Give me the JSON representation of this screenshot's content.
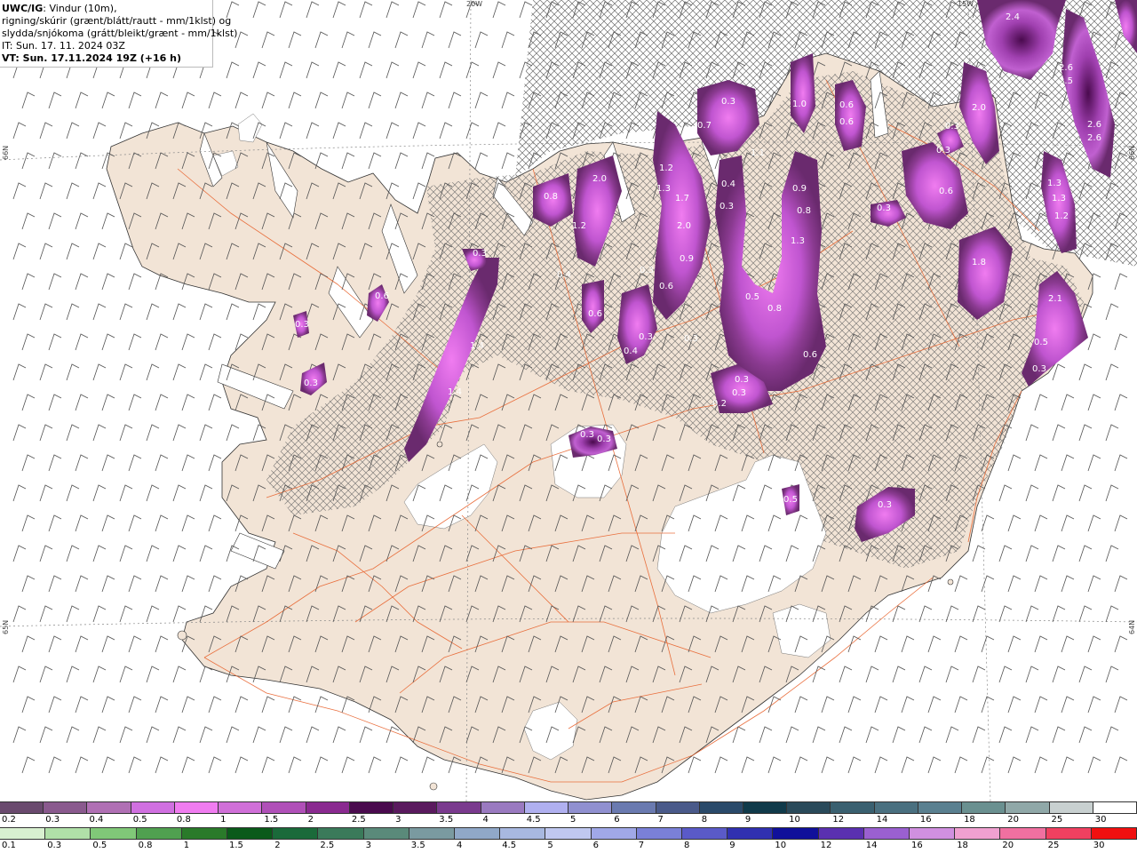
{
  "header": {
    "model": "UWC/IG",
    "line1_rest": ": Vindur (10m),",
    "line2": "rigning/skúrir (grænt/blátt/rautt - mm/1klst) og",
    "line3": "slydda/snjókoma (grátt/bleikt/grænt - mm/1klst)",
    "issue_time": "IT: Sun. 17. 11. 2024 03Z",
    "valid_time": "VT: Sun. 17.11.2024 19Z (+16 h)"
  },
  "grid_labels": {
    "top_20w": "20W",
    "top_15w": "15W",
    "left_66n": "66N",
    "left_65n": "65N",
    "right_66n": "66N",
    "right_64n": "64N"
  },
  "colors": {
    "land": "#f2e4d6",
    "sea": "#ffffff",
    "roads": "#e8622c",
    "hatch": "#6f6f6f",
    "precip_light": "#f07cf0",
    "precip_medium": "#b24ac0",
    "precip_dark": "#6a2a6e"
  },
  "precip_values": [
    {
      "v": "0.3"
    },
    {
      "v": "0.6"
    },
    {
      "v": "0.3"
    },
    {
      "v": "0.3"
    },
    {
      "v": "1.4"
    },
    {
      "v": "1.4"
    },
    {
      "v": "0.8"
    },
    {
      "v": "2.0"
    },
    {
      "v": "1.2"
    },
    {
      "v": "0.4"
    },
    {
      "v": "0.6"
    },
    {
      "v": "0.3"
    },
    {
      "v": "1.2"
    },
    {
      "v": "1.3"
    },
    {
      "v": "1.7"
    },
    {
      "v": "2.0"
    },
    {
      "v": "0.9"
    },
    {
      "v": "0.6"
    },
    {
      "v": "0.3"
    },
    {
      "v": "0.4"
    },
    {
      "v": "0.3"
    },
    {
      "v": "0.7"
    },
    {
      "v": "0.3"
    },
    {
      "v": "1.0"
    },
    {
      "v": "1.1"
    },
    {
      "v": "0.4"
    },
    {
      "v": "0.3"
    },
    {
      "v": "0.9"
    },
    {
      "v": "0.8"
    },
    {
      "v": "1.3"
    },
    {
      "v": "0.5"
    },
    {
      "v": "0.8"
    },
    {
      "v": "0.6"
    },
    {
      "v": "0.3"
    },
    {
      "v": "0.3"
    },
    {
      "v": "0.2"
    },
    {
      "v": "0.6"
    },
    {
      "v": "0.6"
    },
    {
      "v": "0.3"
    },
    {
      "v": "0.6"
    },
    {
      "v": "0.3"
    },
    {
      "v": "0.3"
    },
    {
      "v": "2.0"
    },
    {
      "v": "2.4"
    },
    {
      "v": "2.6"
    },
    {
      "v": "2.5"
    },
    {
      "v": "2.6"
    },
    {
      "v": "2.6"
    },
    {
      "v": "1.3"
    },
    {
      "v": "1.3"
    },
    {
      "v": "1.2"
    },
    {
      "v": "1.8"
    },
    {
      "v": "2.1"
    },
    {
      "v": "0.5"
    },
    {
      "v": "0.3"
    },
    {
      "v": "0.3"
    },
    {
      "v": "0.3"
    },
    {
      "v": "0.5"
    },
    {
      "v": "0.3"
    }
  ],
  "scale_top": {
    "labels": [
      "0.2",
      "0.3",
      "0.4",
      "0.5",
      "0.8",
      "1",
      "1.5",
      "2",
      "2.5",
      "3",
      "3.5",
      "4",
      "4.5",
      "5",
      "6",
      "7",
      "8",
      "9",
      "10",
      "12",
      "14",
      "16",
      "18",
      "20",
      "25",
      "30"
    ],
    "colors": [
      "#6a4a6e",
      "#8a5a8e",
      "#b070b4",
      "#d070e0",
      "#f07cf0",
      "#d070d8",
      "#b050b8",
      "#8a2a90",
      "#4a0a4e",
      "#5a1a5e",
      "#7a3a8e",
      "#9a7ac0",
      "#b0b0f0",
      "#9090d0",
      "#6a7ab0",
      "#4a5a8a",
      "#2a4a6a",
      "#103a4a",
      "#2a4a5a",
      "#3a6070",
      "#4a7080",
      "#5a8090",
      "#6a9090",
      "#90a8a8",
      "#c8d0d0",
      "#ffffff"
    ]
  },
  "scale_bottom": {
    "labels": [
      "0.1",
      "0.3",
      "0.5",
      "0.8",
      "1",
      "1.5",
      "2",
      "2.5",
      "3",
      "3.5",
      "4",
      "4.5",
      "5",
      "6",
      "7",
      "8",
      "9",
      "10",
      "12",
      "14",
      "16",
      "18",
      "20",
      "25",
      "30"
    ],
    "colors": [
      "#d8f0d0",
      "#b0e0a8",
      "#80c878",
      "#50a050",
      "#2a7a2a",
      "#0a5a1a",
      "#1a6a3a",
      "#3a7a5a",
      "#5a8a7a",
      "#7a9aa0",
      "#90a8c8",
      "#a8b8e0",
      "#c0c8f0",
      "#a0a8e8",
      "#7a80d8",
      "#5a5ac8",
      "#3030b0",
      "#10109a",
      "#5a30b0",
      "#9a60d0",
      "#d090e0",
      "#f0a0d0",
      "#f070a0",
      "#f04060",
      "#f01010"
    ]
  }
}
